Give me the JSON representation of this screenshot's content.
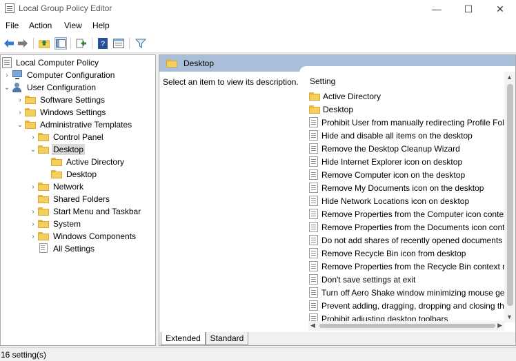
{
  "window": {
    "title": "Local Group Policy Editor",
    "icon": "policy-editor-icon",
    "minimize_icon": "—",
    "maximize_icon": "☐",
    "close_icon": "✕"
  },
  "menu": [
    "File",
    "Action",
    "View",
    "Help"
  ],
  "toolbar": {
    "back_icon": "arrow-left-icon",
    "forward_icon": "arrow-right-icon",
    "up_icon": "folder-up-icon",
    "show_hide_tree_icon": "console-tree-icon",
    "export_icon": "export-list-icon",
    "help_icon": "help-icon",
    "properties_icon": "properties-icon",
    "filter_icon": "filter-icon"
  },
  "tree": {
    "root": "Local Computer Policy",
    "computer_configuration": "Computer Configuration",
    "user_configuration": "User Configuration",
    "software_settings": "Software Settings",
    "windows_settings": "Windows Settings",
    "administrative_templates": "Administrative Templates",
    "control_panel": "Control Panel",
    "desktop": "Desktop",
    "active_directory": "Active Directory",
    "desktop_child": "Desktop",
    "network": "Network",
    "shared_folders": "Shared Folders",
    "start_menu": "Start Menu and Taskbar",
    "system": "System",
    "windows_components": "Windows Components",
    "all_settings": "All Settings"
  },
  "right_pane": {
    "header_title": "Desktop",
    "description": "Select an item to view its description.",
    "column_header": "Setting",
    "items": [
      {
        "type": "folder",
        "label": "Active Directory"
      },
      {
        "type": "folder",
        "label": "Desktop"
      },
      {
        "type": "setting",
        "label": "Prohibit User from manually redirecting Profile Fol"
      },
      {
        "type": "setting",
        "label": "Hide and disable all items on the desktop"
      },
      {
        "type": "setting",
        "label": "Remove the Desktop Cleanup Wizard"
      },
      {
        "type": "setting",
        "label": "Hide Internet Explorer icon on desktop"
      },
      {
        "type": "setting",
        "label": "Remove Computer icon on the desktop"
      },
      {
        "type": "setting",
        "label": "Remove My Documents icon on the desktop"
      },
      {
        "type": "setting",
        "label": "Hide Network Locations icon on desktop"
      },
      {
        "type": "setting",
        "label": "Remove Properties from the Computer icon contex"
      },
      {
        "type": "setting",
        "label": "Remove Properties from the Documents icon cont"
      },
      {
        "type": "setting",
        "label": "Do not add shares of recently opened documents t"
      },
      {
        "type": "setting",
        "label": "Remove Recycle Bin icon from desktop"
      },
      {
        "type": "setting",
        "label": "Remove Properties from the Recycle Bin context m"
      },
      {
        "type": "setting",
        "label": "Don't save settings at exit"
      },
      {
        "type": "setting",
        "label": "Turn off Aero Shake window minimizing mouse ge"
      },
      {
        "type": "setting",
        "label": "Prevent adding, dragging, dropping and closing th"
      },
      {
        "type": "setting",
        "label": "Prohibit adjusting desktop toolbars"
      }
    ],
    "tabs": [
      "Extended",
      "Standard"
    ]
  },
  "status": "16 setting(s)"
}
